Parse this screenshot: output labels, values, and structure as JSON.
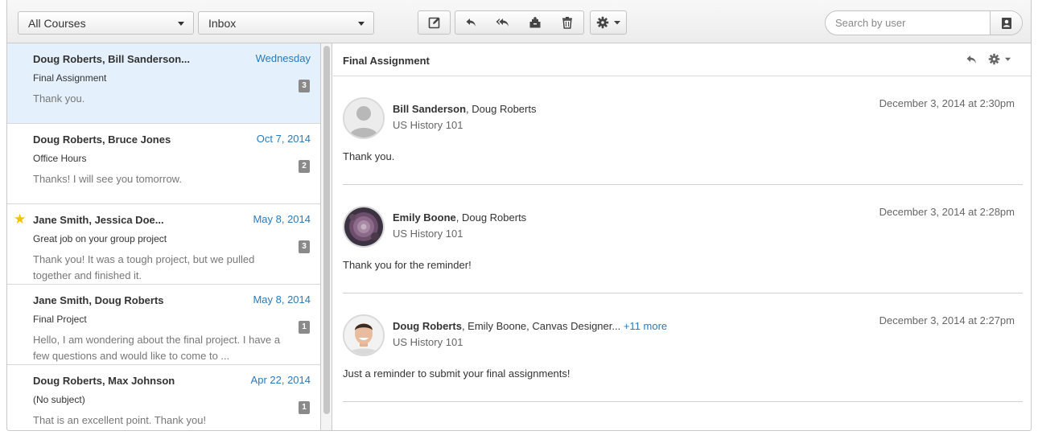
{
  "toolbar": {
    "course_filter": "All Courses",
    "mailbox_filter": "Inbox",
    "search_placeholder": "Search by user"
  },
  "conversations": [
    {
      "names": "Doug Roberts, Bill Sanderson...",
      "date": "Wednesday",
      "subject": "Final Assignment",
      "preview": "Thank you.",
      "count": "3",
      "starred": false,
      "selected": true
    },
    {
      "names": "Doug Roberts, Bruce Jones",
      "date": "Oct 7, 2014",
      "subject": "Office Hours",
      "preview": "Thanks! I will see you tomorrow.",
      "count": "2",
      "starred": false,
      "selected": false
    },
    {
      "names": "Jane Smith, Jessica Doe...",
      "date": "May 8, 2014",
      "subject": "Great job on your group project",
      "preview": "Thank you! It was a tough project, but we pulled together and finished it.",
      "count": "3",
      "starred": true,
      "selected": false
    },
    {
      "names": "Jane Smith, Doug Roberts",
      "date": "May 8, 2014",
      "subject": "Final Project",
      "preview": "Hello, I am wondering about the final project. I have a few questions and would like to come to ...",
      "count": "1",
      "starred": false,
      "selected": false
    },
    {
      "names": "Doug Roberts, Max Johnson",
      "date": "Apr 22, 2014",
      "subject": "(No subject)",
      "preview": "That is an excellent point. Thank you!",
      "count": "1",
      "starred": false,
      "selected": false
    }
  ],
  "thread": {
    "title": "Final Assignment",
    "messages": [
      {
        "sender": "Bill Sanderson",
        "others": ", Doug Roberts",
        "more": "",
        "course": "US History 101",
        "date": "December 3, 2014 at 2:30pm",
        "body": "Thank you.",
        "avatar": "default-avatar-icon"
      },
      {
        "sender": "Emily Boone",
        "others": ", Doug Roberts",
        "more": "",
        "course": "US History 101",
        "date": "December 3, 2014 at 2:28pm",
        "body": "Thank you for the reminder!",
        "avatar": "flower-photo"
      },
      {
        "sender": "Doug Roberts",
        "others": ", Emily Boone, Canvas Designer...",
        "more": "+11 more",
        "course": "US History 101",
        "date": "December 3, 2014 at 2:27pm",
        "body": "Just a reminder to submit your final assignments!",
        "avatar": "man-photo"
      }
    ]
  },
  "colors": {
    "link": "#2a7ab9",
    "selected_row": "#e4f0fb",
    "star": "#f2c100",
    "badge": "#8a8a8a"
  }
}
